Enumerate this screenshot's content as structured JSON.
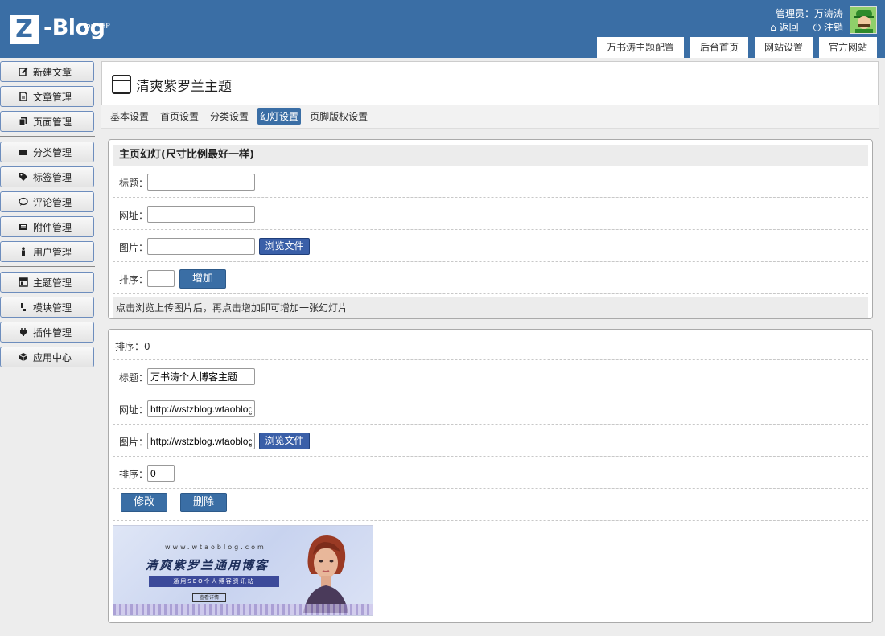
{
  "header": {
    "logo_letter": "Z",
    "logo_text": "Z-Blog",
    "logo_sub": "for PHP",
    "admin_label": "管理员：万涛涛",
    "back_label": "返回",
    "logout_label": "注销",
    "tabs": [
      "万书涛主题配置",
      "后台首页",
      "网站设置",
      "官方网站"
    ]
  },
  "sidebar": {
    "items": [
      {
        "label": "新建文章",
        "icon": "edit-icon"
      },
      {
        "label": "文章管理",
        "icon": "document-icon"
      },
      {
        "label": "页面管理",
        "icon": "page-icon"
      },
      {
        "label": "分类管理",
        "icon": "folder-icon"
      },
      {
        "label": "标签管理",
        "icon": "tag-icon"
      },
      {
        "label": "评论管理",
        "icon": "comment-icon"
      },
      {
        "label": "附件管理",
        "icon": "attachment-icon"
      },
      {
        "label": "用户管理",
        "icon": "user-icon"
      },
      {
        "label": "主题管理",
        "icon": "theme-icon"
      },
      {
        "label": "模块管理",
        "icon": "module-icon"
      },
      {
        "label": "插件管理",
        "icon": "plugin-icon"
      },
      {
        "label": "应用中心",
        "icon": "app-center-icon"
      }
    ]
  },
  "main": {
    "title": "清爽紫罗兰主题",
    "tabs": [
      "基本设置",
      "首页设置",
      "分类设置",
      "幻灯设置",
      "页脚版权设置"
    ],
    "active_tab": "幻灯设置"
  },
  "add_panel": {
    "heading": "主页幻灯(尺寸比例最好一样)",
    "title_label": "标题：",
    "title_value": "",
    "url_label": "网址：",
    "url_value": "",
    "image_label": "图片：",
    "image_value": "",
    "browse_label": "浏览文件",
    "order_label": "排序：",
    "order_value": "",
    "add_label": "增加",
    "hint": "点击浏览上传图片后，再点击增加即可增加一张幻灯片"
  },
  "slide": {
    "order_text": "排序：0",
    "title_label": "标题：",
    "title_value": "万书涛个人博客主题",
    "url_label": "网址：",
    "url_value": "http://wstzblog.wtaoblog.",
    "image_label": "图片：",
    "image_value": "http://wstzblog.wtaoblog.",
    "browse_label": "浏览文件",
    "order_label": "排序：",
    "order_value": "0",
    "edit_label": "修改",
    "delete_label": "删除",
    "banner": {
      "url": "www.wtaoblog.com",
      "title": "清爽紫罗兰通用博客",
      "strip": "通用SEO个人博客资讯站",
      "cta": "查看详情"
    }
  },
  "colors": {
    "header_bg": "#3a6ea5",
    "accent": "#3a6ea5",
    "browse_btn": "#3a5fa8"
  }
}
